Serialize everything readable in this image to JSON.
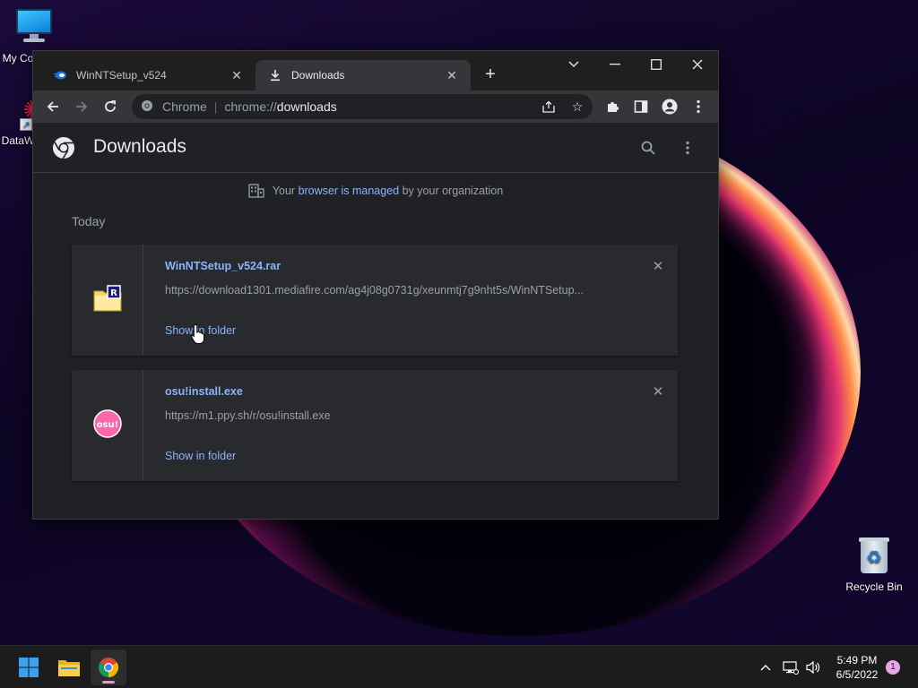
{
  "desktop": {
    "icons": [
      {
        "label": "My Co"
      },
      {
        "label": "DataW"
      },
      {
        "label": "Recycle Bin"
      }
    ]
  },
  "tabs": [
    {
      "label": "WinNTSetup_v524",
      "icon": "mediafire-icon"
    },
    {
      "label": "Downloads",
      "icon": "download-icon"
    }
  ],
  "omnibox": {
    "site": "Chrome",
    "scheme": "chrome://",
    "path": "downloads"
  },
  "page": {
    "title": "Downloads",
    "managed_prefix": "Your",
    "managed_link": "browser is managed",
    "managed_suffix": "by your organization",
    "section_date": "Today"
  },
  "downloads": [
    {
      "filename": "WinNTSetup_v524.rar",
      "url": "https://download1301.mediafire.com/ag4j08g0731g/xeunmtj7g9nht5s/WinNTSetup...",
      "action": "Show in folder",
      "icon": "rar-archive-icon"
    },
    {
      "filename": "osu!install.exe",
      "url": "https://m1.ppy.sh/r/osu!install.exe",
      "action": "Show in folder",
      "icon": "osu-icon",
      "icon_text": "osu!"
    }
  ],
  "taskbar": {
    "time": "5:49 PM",
    "date": "6/5/2022",
    "notifications": "1"
  },
  "colors": {
    "accent": "#8ab4f8",
    "page_bg": "#202124",
    "card_bg": "#292a2d",
    "osu_pink": "#ff66aa"
  }
}
